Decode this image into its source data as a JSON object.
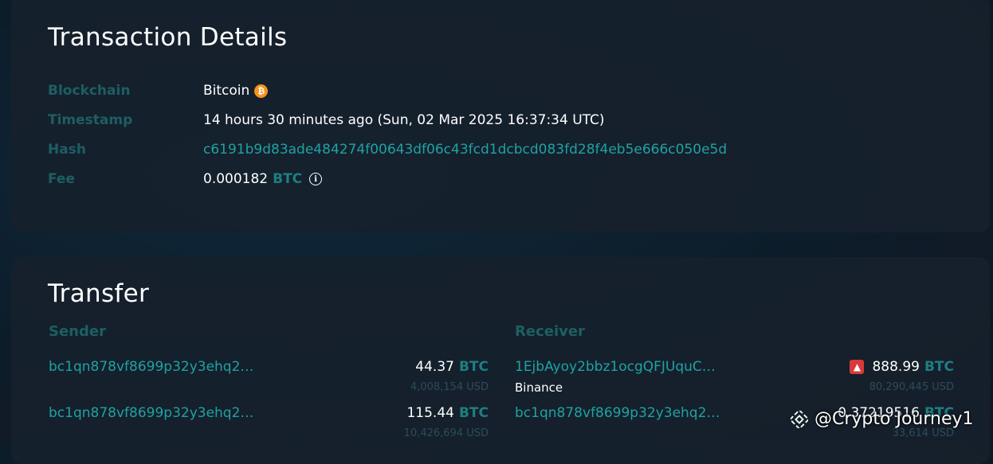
{
  "details": {
    "title": "Transaction Details",
    "rows": [
      {
        "label": "Blockchain",
        "value": "Bitcoin"
      },
      {
        "label": "Timestamp",
        "value": "14 hours 30 minutes ago (Sun, 02 Mar 2025 16:37:34 UTC)"
      },
      {
        "label": "Hash",
        "value": "c6191b9d83ade484274f00643df06c43fcd1dcbcd083fd28f4eb5e666c050e5d"
      },
      {
        "label": "Fee",
        "value": "0.000182",
        "unit": "BTC"
      }
    ],
    "blockchain_icon": "bitcoin-icon",
    "fee_icon": "info-icon"
  },
  "transfer": {
    "title": "Transfer",
    "sender_label": "Sender",
    "receiver_label": "Receiver",
    "senders": [
      {
        "address": "bc1qn878vf8699p32y3ehq2…",
        "amount": "44.37",
        "unit": "BTC",
        "usd": "4,008,154 USD"
      },
      {
        "address": "bc1qn878vf8699p32y3ehq2…",
        "amount": "115.44",
        "unit": "BTC",
        "usd": "10,426,694 USD"
      }
    ],
    "receivers": [
      {
        "address": "1EjbAyoy2bbz1ocgQFJUquC…",
        "entity": "Binance",
        "amount": "888.99",
        "unit": "BTC",
        "usd": "80,290,445 USD",
        "icon": "alert-siren-icon"
      },
      {
        "address": "bc1qn878vf8699p32y3ehq2…",
        "amount": "0.37219516",
        "unit": "BTC",
        "usd": "33,614 USD"
      }
    ]
  },
  "watermark": {
    "text": "@Crypto Journey1",
    "icon": "binance-logo-icon"
  },
  "colors": {
    "accent": "#1fa2a2",
    "label": "#1d5f63",
    "bitcoin": "#f7931a",
    "alert": "#d93a3a"
  }
}
